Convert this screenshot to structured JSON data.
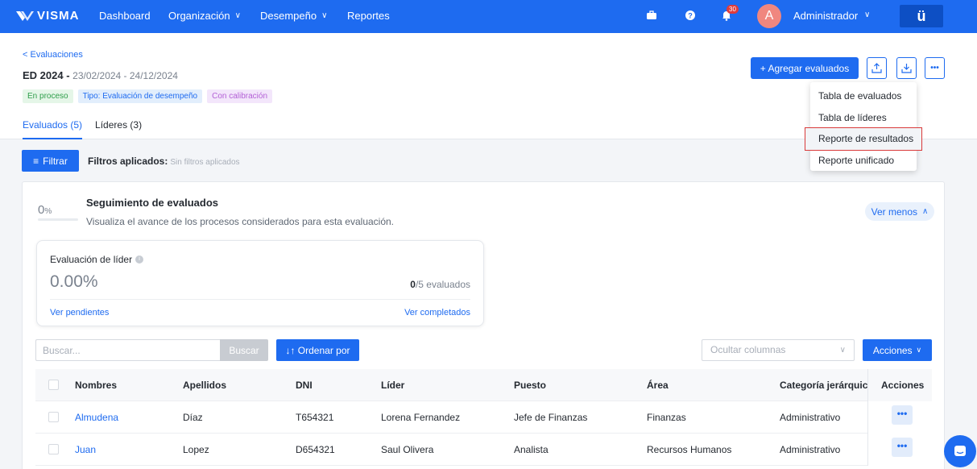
{
  "nav": {
    "logo": "VISMA",
    "items": [
      {
        "label": "Dashboard",
        "has_dropdown": false
      },
      {
        "label": "Organización",
        "has_dropdown": true
      },
      {
        "label": "Desempeño",
        "has_dropdown": true
      },
      {
        "label": "Reportes",
        "has_dropdown": false
      }
    ],
    "notification_count": "30",
    "avatar_initial": "A",
    "user_name": "Administrador",
    "brand_button": "ü",
    "icons": [
      "briefcase-icon",
      "help-icon",
      "bell-icon"
    ]
  },
  "header": {
    "back_link": "< Evaluaciones",
    "title": "ED 2024 - ",
    "dates": "23/02/2024 - 24/12/2024",
    "tags": [
      "En proceso",
      "Tipo: Evaluación de desempeño",
      "Con calibración"
    ],
    "tabs": [
      {
        "label": "Evaluados (5)",
        "active": true
      },
      {
        "label": "Líderes (3)",
        "active": false
      }
    ],
    "add_button": "+ Agregar evaluados",
    "more_button": "•••"
  },
  "dropdown": {
    "items": [
      "Tabla de evaluados",
      "Tabla de líderes",
      "Reporte de resultados",
      "Reporte unificado"
    ],
    "highlighted": "Reporte de resultados"
  },
  "filters": {
    "button": "Filtrar",
    "label": "Filtros aplicados:",
    "value": "Sin filtros aplicados"
  },
  "tracking": {
    "percent": "0",
    "percent_unit": "%",
    "title": "Seguimiento de evaluados",
    "description": "Visualiza el avance de los procesos considerados para esta evaluación.",
    "toggle": "Ver menos",
    "leader_eval": {
      "title": "Evaluación de líder",
      "percent": "0.00%",
      "done": "0",
      "total_text": "/5 evaluados",
      "pending_link": "Ver pendientes",
      "completed_link": "Ver completados"
    }
  },
  "toolbar": {
    "search_placeholder": "Buscar...",
    "search_button": "Buscar",
    "sort_button": "↓↑ Ordenar por",
    "hide_columns_placeholder": "Ocultar columnas",
    "actions_button": "Acciones"
  },
  "table": {
    "columns": [
      "Nombres",
      "Apellidos",
      "DNI",
      "Líder",
      "Puesto",
      "Área",
      "Categoría jerárquica",
      "Acciones"
    ],
    "rows": [
      {
        "nombres": "Almudena",
        "apellidos": "Díaz",
        "dni": "T654321",
        "lider": "Lorena Fernandez",
        "puesto": "Jefe de Finanzas",
        "area": "Finanzas",
        "categoria": "Administrativo"
      },
      {
        "nombres": "Juan",
        "apellidos": "Lopez",
        "dni": "D654321",
        "lider": "Saul Olivera",
        "puesto": "Analista",
        "area": "Recursos Humanos",
        "categoria": "Administrativo"
      }
    ]
  },
  "colors": {
    "primary": "#1e6bf0",
    "nav": "#1e6bf0",
    "highlight_border": "#d93a3a"
  }
}
